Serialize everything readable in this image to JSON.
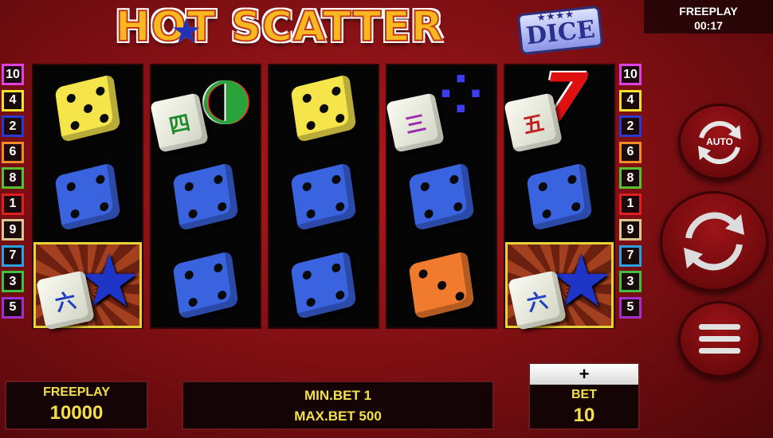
{
  "title": {
    "main_text": "HOT SCATTER",
    "badge_text": "DICE",
    "badge_stars": "★★★★"
  },
  "timer": {
    "label": "FREEPLAY",
    "value": "00:17"
  },
  "paylines": {
    "left": [
      "10",
      "4",
      "2",
      "6",
      "8",
      "1",
      "9",
      "7",
      "3",
      "5"
    ],
    "right": [
      "10",
      "4",
      "2",
      "6",
      "8",
      "1",
      "9",
      "7",
      "3",
      "5"
    ],
    "colors": {
      "10": "#e040e0",
      "4": "#f0e030",
      "2": "#2a3ad0",
      "6": "#f08a2a",
      "8": "#58c030",
      "1": "#e02020",
      "9": "#d8c890",
      "7": "#2aa0e0",
      "3": "#40c040",
      "5": "#a030d0"
    }
  },
  "reels": [
    [
      {
        "type": "die",
        "color": "yellow",
        "pips": 5
      },
      {
        "type": "die",
        "color": "blue",
        "pips": 4
      },
      {
        "type": "scatter",
        "tile": "六",
        "highlight": true
      }
    ],
    [
      {
        "type": "tile-melon",
        "tile": "四"
      },
      {
        "type": "die",
        "color": "blue",
        "pips": 4
      },
      {
        "type": "die",
        "color": "blue",
        "pips": 4
      }
    ],
    [
      {
        "type": "die",
        "color": "yellow",
        "pips": 5
      },
      {
        "type": "die",
        "color": "blue",
        "pips": 4
      },
      {
        "type": "die",
        "color": "blue",
        "pips": 4
      }
    ],
    [
      {
        "type": "tile-grapes",
        "tile": "三"
      },
      {
        "type": "die",
        "color": "blue",
        "pips": 4
      },
      {
        "type": "die",
        "color": "orange",
        "pips": 3
      }
    ],
    [
      {
        "type": "tile-seven",
        "tile": "五"
      },
      {
        "type": "die",
        "color": "blue",
        "pips": 4
      },
      {
        "type": "scatter",
        "tile": "六",
        "highlight": true
      }
    ]
  ],
  "buttons": {
    "auto_label": "AUTO",
    "spin_icon": "refresh-icon",
    "menu_icon": "hamburger-menu-icon"
  },
  "bottom": {
    "freeplay_label": "FREEPLAY",
    "freeplay_value": "10000",
    "min_bet": "MIN.BET 1",
    "max_bet": "MAX.BET 500",
    "bet_plus": "+",
    "bet_label": "BET",
    "bet_value": "10"
  }
}
